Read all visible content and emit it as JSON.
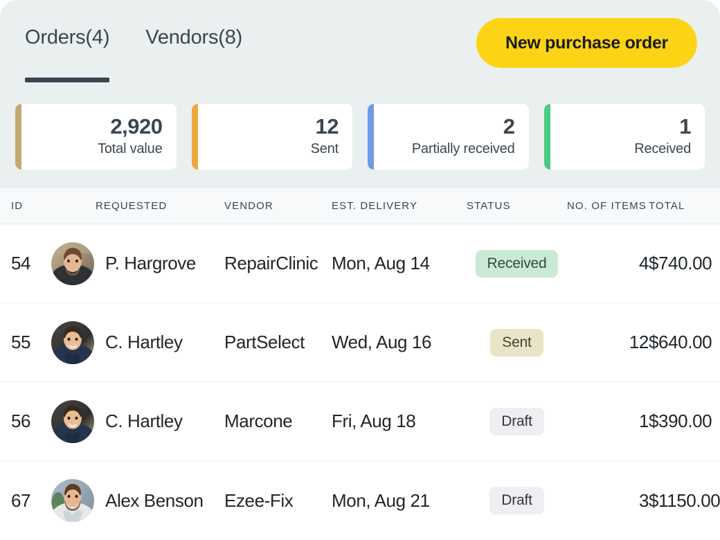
{
  "header": {
    "tabs": [
      {
        "label": "Orders(4)",
        "active": true
      },
      {
        "label": "Vendors(8)",
        "active": false
      }
    ],
    "primary_button": {
      "label": "New purchase order",
      "background": "#fcd415",
      "text_color": "#1b1b1b"
    },
    "background": "#eaeff0"
  },
  "stats": [
    {
      "value": "2,920",
      "label": "Total value",
      "accent": "#c3a871"
    },
    {
      "value": "12",
      "label": "Sent",
      "accent": "#f0a73e"
    },
    {
      "value": "2",
      "label": "Partially received",
      "accent": "#6e9be4"
    },
    {
      "value": "1",
      "label": "Received",
      "accent": "#4cc983"
    }
  ],
  "table": {
    "columns": [
      "ID",
      "REQUESTED",
      "VENDOR",
      "EST. DELIVERY",
      "STATUS",
      "NO. OF ITEMS",
      "TOTAL"
    ],
    "rows": [
      {
        "id": "54",
        "requested_by": "P. Hargrove",
        "avatar": "avatar-hargrove",
        "vendor": "RepairClinic",
        "est_delivery": "Mon, Aug 14",
        "status": "Received",
        "status_style": "received",
        "no_of_items": "4",
        "total": "$740.00"
      },
      {
        "id": "55",
        "requested_by": "C. Hartley",
        "avatar": "avatar-hartley",
        "vendor": "PartSelect",
        "est_delivery": "Wed, Aug 16",
        "status": "Sent",
        "status_style": "sent",
        "no_of_items": "12",
        "total": "$640.00"
      },
      {
        "id": "56",
        "requested_by": "C. Hartley",
        "avatar": "avatar-hartley",
        "vendor": "Marcone",
        "est_delivery": "Fri, Aug 18",
        "status": "Draft",
        "status_style": "draft",
        "no_of_items": "1",
        "total": "$390.00"
      },
      {
        "id": "67",
        "requested_by": "Alex Benson",
        "avatar": "avatar-benson",
        "vendor": "Ezee-Fix",
        "est_delivery": "Mon, Aug 21",
        "status": "Draft",
        "status_style": "draft",
        "no_of_items": "3",
        "total": "$1150.00"
      }
    ]
  },
  "colors": {
    "badge_received_bg": "#cbe9d7",
    "badge_sent_bg": "#eae3c8",
    "badge_draft_bg": "#eeeef3",
    "table_header_bg": "#f7f9fa",
    "row_bg": "#ffffff",
    "text_primary": "#20262b",
    "text_muted": "#3b4650"
  }
}
